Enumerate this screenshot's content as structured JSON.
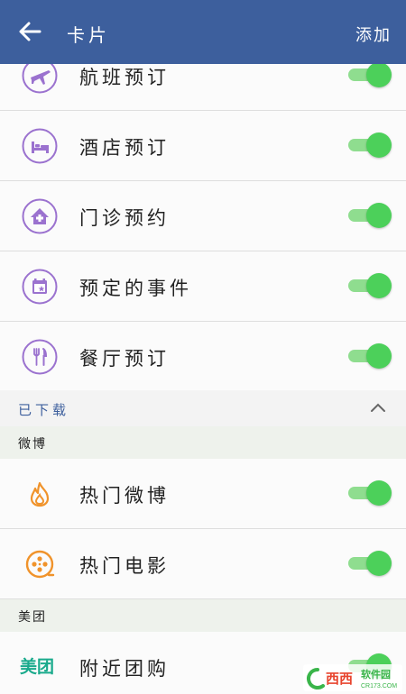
{
  "header": {
    "title": "卡片",
    "add_label": "添加",
    "color": "#3d5f9d"
  },
  "cards": [
    {
      "label": "航班预订",
      "icon": "airplane-icon",
      "enabled": true
    },
    {
      "label": "酒店预订",
      "icon": "hotel-bed-icon",
      "enabled": true
    },
    {
      "label": "门诊预约",
      "icon": "clinic-house-icon",
      "enabled": true
    },
    {
      "label": "预定的事件",
      "icon": "calendar-event-icon",
      "enabled": true
    },
    {
      "label": "餐厅预订",
      "icon": "fork-knife-icon",
      "enabled": true
    }
  ],
  "downloaded": {
    "title": "已下载",
    "groups": [
      {
        "name": "微博",
        "items": [
          {
            "label": "热门微博",
            "icon": "flame-icon",
            "enabled": true
          },
          {
            "label": "热门电影",
            "icon": "film-reel-icon",
            "enabled": true
          }
        ]
      },
      {
        "name": "美团",
        "items": [
          {
            "label": "附近团购",
            "icon_text": "美团",
            "enabled": true
          }
        ]
      }
    ]
  },
  "watermark": {
    "text": "西西",
    "small": "软件园",
    "url": "CR173.COM"
  },
  "colors": {
    "icon_purple": "#9b72cf",
    "orange": "#f0932b",
    "switch_on": "#4cd05a",
    "meituan": "#1aaa8c"
  }
}
